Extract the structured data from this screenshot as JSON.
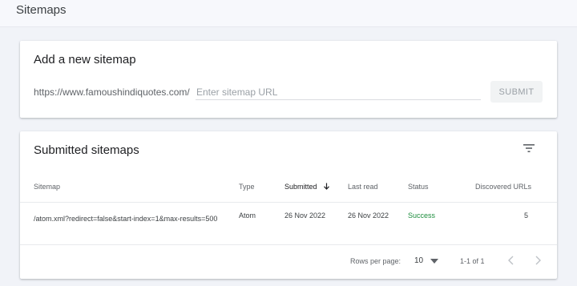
{
  "header": {
    "title": "Sitemaps"
  },
  "add_card": {
    "title": "Add a new sitemap",
    "url_prefix": "https://www.famoushindiquotes.com/",
    "input_placeholder": "Enter sitemap URL",
    "input_value": "",
    "submit_label": "SUBMIT"
  },
  "submitted_card": {
    "title": "Submitted sitemaps",
    "filter_icon": "filter-icon",
    "columns": {
      "sitemap": "Sitemap",
      "type": "Type",
      "submitted": "Submitted",
      "last_read": "Last read",
      "status": "Status",
      "discovered": "Discovered URLs"
    },
    "sort_icon": "arrow-down-icon",
    "rows": [
      {
        "sitemap": "/atom.xml?redirect=false&start-index=1&max-results=500",
        "type": "Atom",
        "submitted": "26 Nov 2022",
        "last_read": "26 Nov 2022",
        "status": "Success",
        "discovered": "5"
      }
    ],
    "pagination": {
      "rows_per_page_label": "Rows per page:",
      "rows_per_page_value": "10",
      "range": "1-1 of 1",
      "prev_icon": "chevron-left-icon",
      "next_icon": "chevron-right-icon"
    }
  },
  "colors": {
    "background": "#f1f3f8",
    "success": "#1e8e3e",
    "muted": "#5f6368"
  }
}
